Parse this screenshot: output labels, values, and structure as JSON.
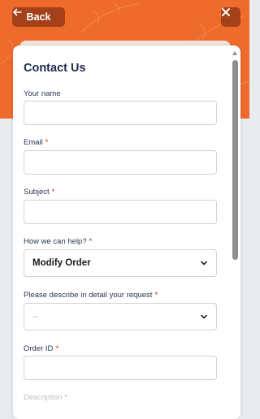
{
  "header": {
    "back_label": "Back",
    "back_icon": "arrow-left-icon",
    "close_icon": "close-icon",
    "accent_color": "#ee6b2c",
    "button_color": "#a4401a"
  },
  "form": {
    "title": "Contact Us",
    "required_marker": "*",
    "fields": {
      "name": {
        "label": "Your name",
        "value": ""
      },
      "email": {
        "label": "Email",
        "value": ""
      },
      "subject": {
        "label": "Subject",
        "value": ""
      },
      "help": {
        "label": "How we can help?",
        "value": "Modify Order"
      },
      "details": {
        "label": "Please describe in detail your request",
        "value": "--"
      },
      "order_id": {
        "label": "Order ID",
        "value": ""
      },
      "description": {
        "label": "Description"
      }
    }
  }
}
